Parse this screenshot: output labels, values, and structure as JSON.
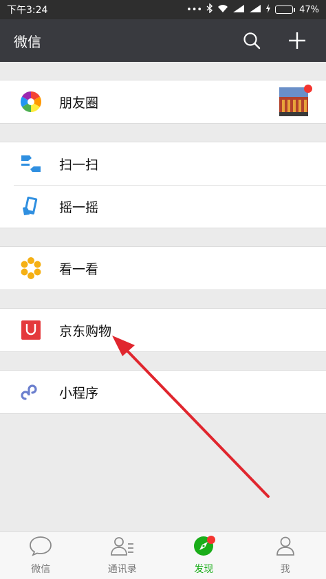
{
  "status_bar": {
    "time": "下午3:24",
    "dots": "•••",
    "battery": "47%",
    "battery_level": 0.47
  },
  "header": {
    "title": "微信",
    "search_icon": "search-icon",
    "add_icon": "plus-icon"
  },
  "discover": {
    "moments": {
      "label": "朋友圈",
      "icon": "aperture-icon"
    },
    "scan": {
      "label": "扫一扫",
      "icon": "scan-icon"
    },
    "shake": {
      "label": "摇一摇",
      "icon": "shake-phone-icon"
    },
    "look": {
      "label": "看一看",
      "icon": "top-stories-icon"
    },
    "jd": {
      "label": "京东购物",
      "icon": "jd-shopping-icon"
    },
    "miniprogram": {
      "label": "小程序",
      "icon": "mini-program-icon"
    }
  },
  "tabs": [
    {
      "label": "微信",
      "icon": "chat-bubble-icon",
      "active": false
    },
    {
      "label": "通讯录",
      "icon": "contacts-icon",
      "active": false
    },
    {
      "label": "发现",
      "icon": "compass-icon",
      "active": true
    },
    {
      "label": "我",
      "icon": "person-icon",
      "active": false
    }
  ],
  "colors": {
    "accent": "#1aad19",
    "badge": "#f43530",
    "arrow": "#e0262e",
    "nav": "#393a3f"
  }
}
